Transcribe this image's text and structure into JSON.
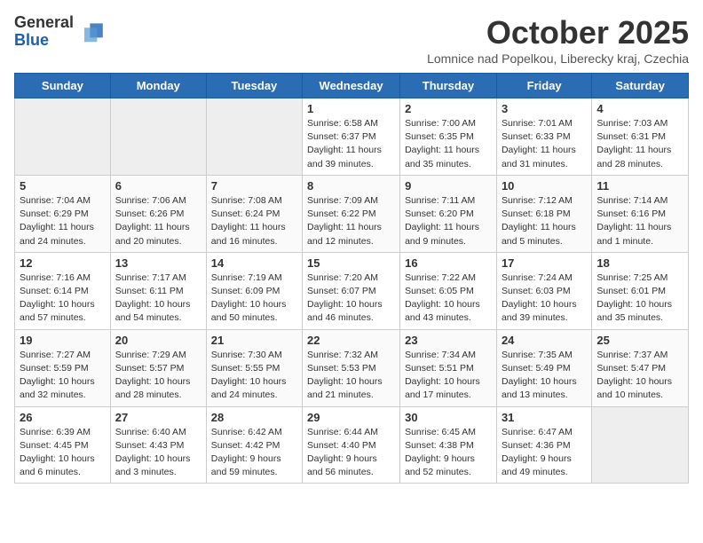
{
  "logo": {
    "general": "General",
    "blue": "Blue"
  },
  "title": "October 2025",
  "subtitle": "Lomnice nad Popelkou, Liberecky kraj, Czechia",
  "days_of_week": [
    "Sunday",
    "Monday",
    "Tuesday",
    "Wednesday",
    "Thursday",
    "Friday",
    "Saturday"
  ],
  "weeks": [
    [
      {
        "day": "",
        "info": ""
      },
      {
        "day": "",
        "info": ""
      },
      {
        "day": "",
        "info": ""
      },
      {
        "day": "1",
        "info": "Sunrise: 6:58 AM\nSunset: 6:37 PM\nDaylight: 11 hours\nand 39 minutes."
      },
      {
        "day": "2",
        "info": "Sunrise: 7:00 AM\nSunset: 6:35 PM\nDaylight: 11 hours\nand 35 minutes."
      },
      {
        "day": "3",
        "info": "Sunrise: 7:01 AM\nSunset: 6:33 PM\nDaylight: 11 hours\nand 31 minutes."
      },
      {
        "day": "4",
        "info": "Sunrise: 7:03 AM\nSunset: 6:31 PM\nDaylight: 11 hours\nand 28 minutes."
      }
    ],
    [
      {
        "day": "5",
        "info": "Sunrise: 7:04 AM\nSunset: 6:29 PM\nDaylight: 11 hours\nand 24 minutes."
      },
      {
        "day": "6",
        "info": "Sunrise: 7:06 AM\nSunset: 6:26 PM\nDaylight: 11 hours\nand 20 minutes."
      },
      {
        "day": "7",
        "info": "Sunrise: 7:08 AM\nSunset: 6:24 PM\nDaylight: 11 hours\nand 16 minutes."
      },
      {
        "day": "8",
        "info": "Sunrise: 7:09 AM\nSunset: 6:22 PM\nDaylight: 11 hours\nand 12 minutes."
      },
      {
        "day": "9",
        "info": "Sunrise: 7:11 AM\nSunset: 6:20 PM\nDaylight: 11 hours\nand 9 minutes."
      },
      {
        "day": "10",
        "info": "Sunrise: 7:12 AM\nSunset: 6:18 PM\nDaylight: 11 hours\nand 5 minutes."
      },
      {
        "day": "11",
        "info": "Sunrise: 7:14 AM\nSunset: 6:16 PM\nDaylight: 11 hours\nand 1 minute."
      }
    ],
    [
      {
        "day": "12",
        "info": "Sunrise: 7:16 AM\nSunset: 6:14 PM\nDaylight: 10 hours\nand 57 minutes."
      },
      {
        "day": "13",
        "info": "Sunrise: 7:17 AM\nSunset: 6:11 PM\nDaylight: 10 hours\nand 54 minutes."
      },
      {
        "day": "14",
        "info": "Sunrise: 7:19 AM\nSunset: 6:09 PM\nDaylight: 10 hours\nand 50 minutes."
      },
      {
        "day": "15",
        "info": "Sunrise: 7:20 AM\nSunset: 6:07 PM\nDaylight: 10 hours\nand 46 minutes."
      },
      {
        "day": "16",
        "info": "Sunrise: 7:22 AM\nSunset: 6:05 PM\nDaylight: 10 hours\nand 43 minutes."
      },
      {
        "day": "17",
        "info": "Sunrise: 7:24 AM\nSunset: 6:03 PM\nDaylight: 10 hours\nand 39 minutes."
      },
      {
        "day": "18",
        "info": "Sunrise: 7:25 AM\nSunset: 6:01 PM\nDaylight: 10 hours\nand 35 minutes."
      }
    ],
    [
      {
        "day": "19",
        "info": "Sunrise: 7:27 AM\nSunset: 5:59 PM\nDaylight: 10 hours\nand 32 minutes."
      },
      {
        "day": "20",
        "info": "Sunrise: 7:29 AM\nSunset: 5:57 PM\nDaylight: 10 hours\nand 28 minutes."
      },
      {
        "day": "21",
        "info": "Sunrise: 7:30 AM\nSunset: 5:55 PM\nDaylight: 10 hours\nand 24 minutes."
      },
      {
        "day": "22",
        "info": "Sunrise: 7:32 AM\nSunset: 5:53 PM\nDaylight: 10 hours\nand 21 minutes."
      },
      {
        "day": "23",
        "info": "Sunrise: 7:34 AM\nSunset: 5:51 PM\nDaylight: 10 hours\nand 17 minutes."
      },
      {
        "day": "24",
        "info": "Sunrise: 7:35 AM\nSunset: 5:49 PM\nDaylight: 10 hours\nand 13 minutes."
      },
      {
        "day": "25",
        "info": "Sunrise: 7:37 AM\nSunset: 5:47 PM\nDaylight: 10 hours\nand 10 minutes."
      }
    ],
    [
      {
        "day": "26",
        "info": "Sunrise: 6:39 AM\nSunset: 4:45 PM\nDaylight: 10 hours\nand 6 minutes."
      },
      {
        "day": "27",
        "info": "Sunrise: 6:40 AM\nSunset: 4:43 PM\nDaylight: 10 hours\nand 3 minutes."
      },
      {
        "day": "28",
        "info": "Sunrise: 6:42 AM\nSunset: 4:42 PM\nDaylight: 9 hours\nand 59 minutes."
      },
      {
        "day": "29",
        "info": "Sunrise: 6:44 AM\nSunset: 4:40 PM\nDaylight: 9 hours\nand 56 minutes."
      },
      {
        "day": "30",
        "info": "Sunrise: 6:45 AM\nSunset: 4:38 PM\nDaylight: 9 hours\nand 52 minutes."
      },
      {
        "day": "31",
        "info": "Sunrise: 6:47 AM\nSunset: 4:36 PM\nDaylight: 9 hours\nand 49 minutes."
      },
      {
        "day": "",
        "info": ""
      }
    ]
  ]
}
